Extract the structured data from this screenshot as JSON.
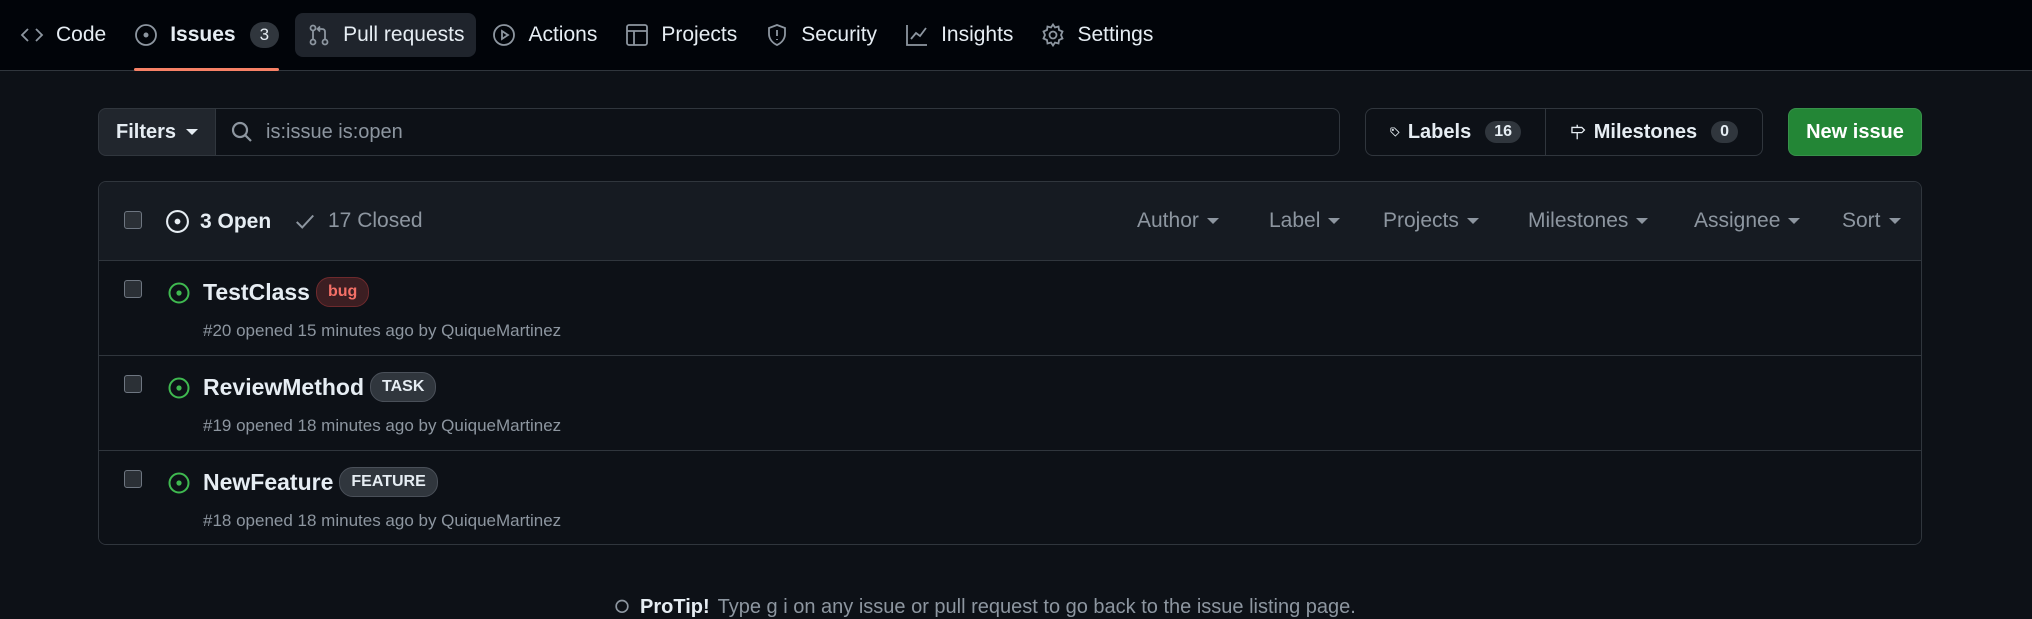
{
  "nav": {
    "tabs": [
      {
        "label": "Code",
        "icon": "code-icon"
      },
      {
        "label": "Issues",
        "icon": "issue-opened-icon",
        "count": "3",
        "selected": true
      },
      {
        "label": "Pull requests",
        "icon": "git-pull-request-icon"
      },
      {
        "label": "Actions",
        "icon": "play-icon"
      },
      {
        "label": "Projects",
        "icon": "table-icon"
      },
      {
        "label": "Security",
        "icon": "shield-icon"
      },
      {
        "label": "Insights",
        "icon": "graph-icon"
      },
      {
        "label": "Settings",
        "icon": "gear-icon"
      }
    ]
  },
  "toolbar": {
    "filters_label": "Filters",
    "search_value": "is:issue is:open",
    "labels_label": "Labels",
    "labels_count": "16",
    "milestones_label": "Milestones",
    "milestones_count": "0",
    "new_issue_label": "New issue"
  },
  "list": {
    "open_label": "3 Open",
    "closed_label": "17 Closed",
    "filters": [
      "Author",
      "Label",
      "Projects",
      "Milestones",
      "Assignee",
      "Sort"
    ],
    "issues": [
      {
        "title": "TestClass",
        "label": "bug",
        "meta": "#20 opened 15 minutes ago by QuiqueMartinez"
      },
      {
        "title": "ReviewMethod",
        "label": "TASK",
        "meta": "#19 opened 18 minutes ago by QuiqueMartinez"
      },
      {
        "title": "NewFeature",
        "label": "FEATURE",
        "meta": "#18 opened 18 minutes ago by QuiqueMartinez"
      }
    ]
  },
  "footer": {
    "protip_bold": "ProTip!",
    "protip_text": "Type g i on any issue or pull request to go back to the issue listing page."
  },
  "colors": {
    "accent_tab": "#f78166",
    "new_issue_bg": "#238636",
    "open_icon": "#3fb950",
    "bug_label": "#f47067"
  }
}
